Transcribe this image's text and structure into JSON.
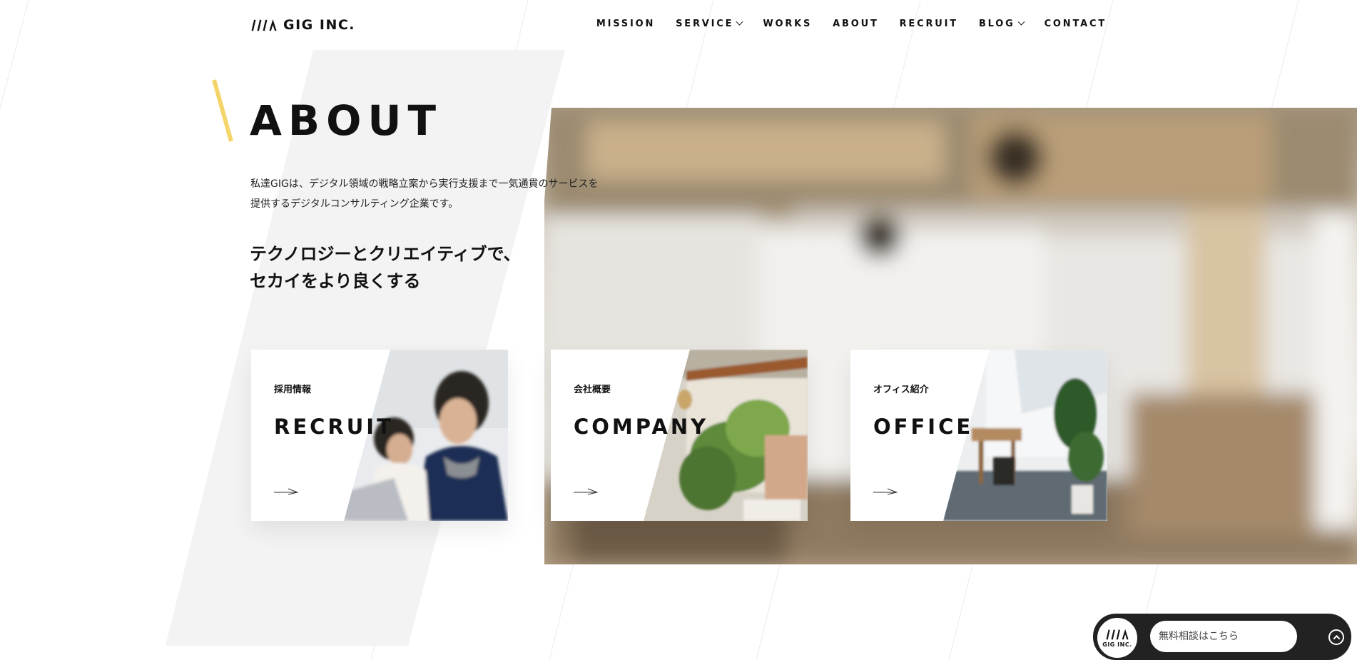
{
  "header": {
    "logo_text": "GIG INC.",
    "nav": [
      {
        "label": "MISSION",
        "has_dropdown": false
      },
      {
        "label": "SERVICE",
        "has_dropdown": true
      },
      {
        "label": "WORKS",
        "has_dropdown": false
      },
      {
        "label": "ABOUT",
        "has_dropdown": false
      },
      {
        "label": "RECRUIT",
        "has_dropdown": false
      },
      {
        "label": "BLOG",
        "has_dropdown": true
      },
      {
        "label": "CONTACT",
        "has_dropdown": false
      }
    ]
  },
  "about": {
    "title": "ABOUT",
    "description_line1": "私達GIGは、デジタル領域の戦略立案から実行支援まで一気通貫のサービスを",
    "description_line2": "提供するデジタルコンサルティング企業です。",
    "catch_line1": "テクノロジーとクリエイティブで、",
    "catch_line2": "セカイをより良くする"
  },
  "cards": [
    {
      "subtitle": "採用情報",
      "title": "RECRUIT",
      "icon": "arrow-right-icon"
    },
    {
      "subtitle": "会社概要",
      "title": "COMPANY",
      "icon": "arrow-right-icon"
    },
    {
      "subtitle": "オフィス紹介",
      "title": "OFFICE",
      "icon": "arrow-right-icon"
    }
  ],
  "chat": {
    "logo_text": "GIG INC.",
    "placeholder": "無料相談はこちら",
    "toggle_icon": "chevron-up-icon"
  },
  "colors": {
    "accent_yellow": "#f4d56a",
    "text": "#111111",
    "grey_shape": "#f3f3f3",
    "chat_bg": "#222222"
  }
}
